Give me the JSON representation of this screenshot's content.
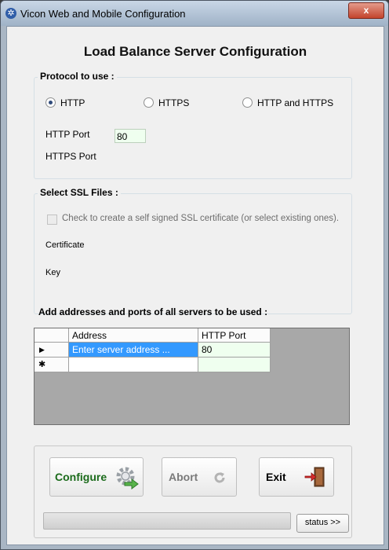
{
  "window": {
    "title": "Vicon Web and Mobile Configuration",
    "close_label": "x"
  },
  "heading": "Load Balance Server Configuration",
  "protocol_group": {
    "legend": "Protocol to use :",
    "options": [
      "HTTP",
      "HTTPS",
      "HTTP and HTTPS"
    ],
    "selected": "HTTP",
    "http_port_label": "HTTP Port",
    "http_port_value": "80",
    "https_port_label": "HTTPS Port"
  },
  "ssl_group": {
    "legend": "Select SSL Files :",
    "checkbox_label": "Check to create a self signed SSL certificate (or select existing ones).",
    "certificate_label": "Certificate",
    "key_label": "Key"
  },
  "servers": {
    "label": "Add addresses and ports of all servers to be used :",
    "columns": [
      "Address",
      "HTTP Port"
    ],
    "rows": [
      {
        "marker": "▶",
        "address": "Enter server address ...",
        "port": "80"
      },
      {
        "marker": "✱",
        "address": "",
        "port": ""
      }
    ]
  },
  "buttons": {
    "configure": "Configure",
    "abort": "Abort",
    "exit": "Exit",
    "status": "status >>"
  },
  "colors": {
    "selected_cell": "#3399ff",
    "port_cell": "#efffef",
    "configure_text": "#1b6b1b"
  },
  "icons": {
    "app": "vicon-logo-icon",
    "configure": "gear-arrow-icon",
    "abort": "refresh-icon",
    "exit": "exit-door-icon"
  }
}
